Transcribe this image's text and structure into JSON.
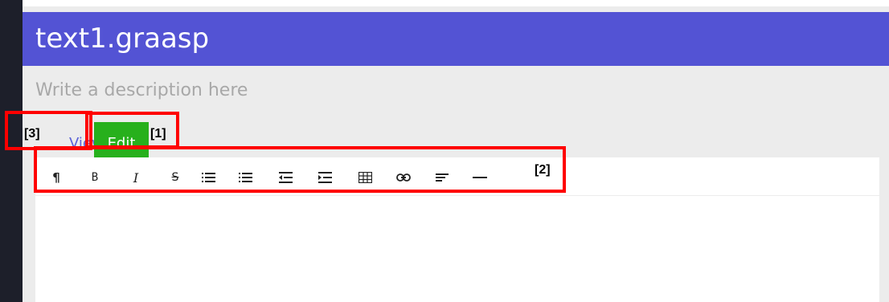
{
  "document": {
    "title": "text1.graasp",
    "description_placeholder": "Write a description here"
  },
  "mode_tabs": {
    "view_label": "View",
    "edit_label": "Edit"
  },
  "toolbar": {
    "tools": [
      {
        "name": "paragraph",
        "glyph": "¶"
      },
      {
        "name": "bold",
        "glyph": "B"
      },
      {
        "name": "italic",
        "glyph": "I"
      },
      {
        "name": "strikethrough",
        "glyph": "S"
      },
      {
        "name": "unordered-list",
        "glyph": ""
      },
      {
        "name": "ordered-list",
        "glyph": ""
      },
      {
        "name": "outdent",
        "glyph": ""
      },
      {
        "name": "indent",
        "glyph": ""
      },
      {
        "name": "table",
        "glyph": ""
      },
      {
        "name": "link",
        "glyph": ""
      },
      {
        "name": "align",
        "glyph": ""
      },
      {
        "name": "horizontal-rule",
        "glyph": ""
      }
    ]
  },
  "annotations": [
    "[1]",
    "[2]",
    "[3]"
  ],
  "colors": {
    "header": "#5353d4",
    "edit_button": "#27b01c",
    "view_link": "#5b63d8",
    "annotation_box": "#ff0000"
  }
}
